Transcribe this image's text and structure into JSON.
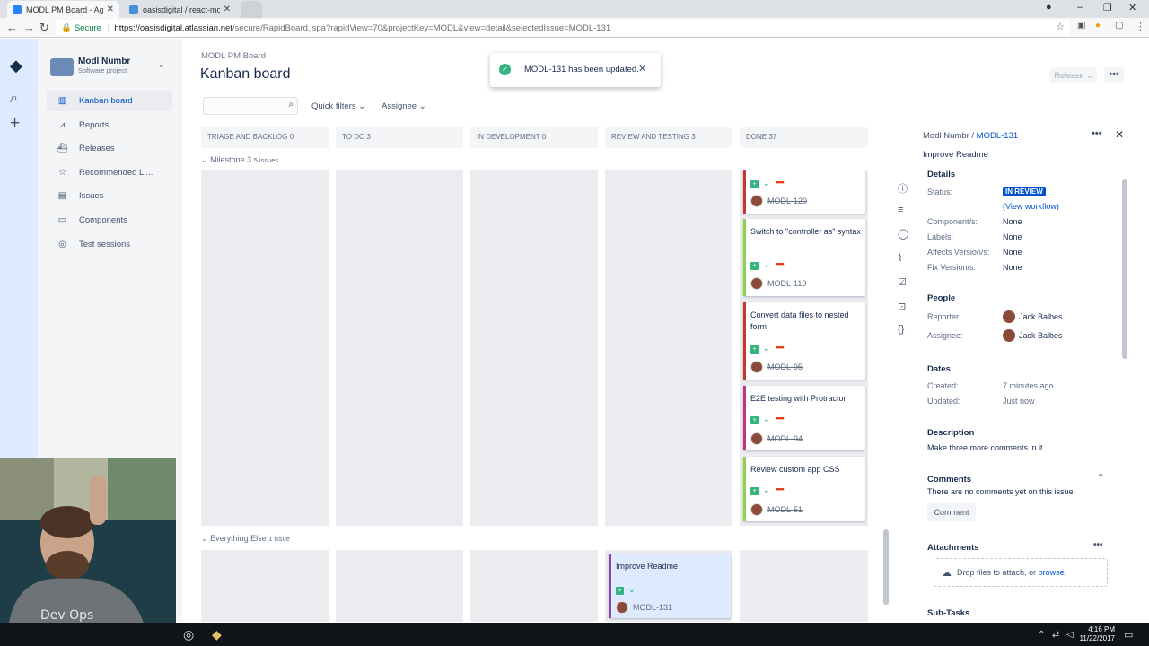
{
  "browser": {
    "tabs": [
      {
        "label": "MODL PM Board - Agile",
        "active": true
      },
      {
        "label": "oasisdigital / react-modl",
        "active": false
      }
    ],
    "secure_label": "Secure",
    "url_host": "https://oasisdigital.atlassian.net",
    "url_path": "/secure/RapidBoard.jspa?rapidView=70&projectKey=MODL&view=detail&selectedIssue=MODL-131"
  },
  "project": {
    "name": "Modl Numbr",
    "type": "Software project"
  },
  "nav": {
    "items": [
      {
        "label": "Kanban board",
        "icon": "board-icon",
        "selected": true
      },
      {
        "label": "Reports",
        "icon": "chart-icon",
        "selected": false
      },
      {
        "label": "Releases",
        "icon": "ship-icon",
        "selected": false
      },
      {
        "label": "Recommended Li...",
        "icon": "star-icon",
        "selected": false
      },
      {
        "label": "Issues",
        "icon": "issues-icon",
        "selected": false
      },
      {
        "label": "Components",
        "icon": "folder-icon",
        "selected": false
      },
      {
        "label": "Test sessions",
        "icon": "compass-icon",
        "selected": false
      }
    ]
  },
  "header": {
    "breadcrumb": "MODL PM Board",
    "title": "Kanban board",
    "quick_filters": "Quick filters",
    "assignee": "Assignee",
    "release": "Release"
  },
  "toast": {
    "message": "MODL-131 has been updated."
  },
  "board": {
    "columns": [
      "TRIAGE AND BACKLOG 0",
      "TO DO 3",
      "IN DEVELOPMENT 0",
      "REVIEW AND TESTING 3",
      "DONE 37"
    ],
    "swimlanes": [
      {
        "name": "Milestone 3",
        "count": "5 issues"
      },
      {
        "name": "Everything Else",
        "count": "1 issue"
      }
    ],
    "done_cards": [
      {
        "summary": "",
        "key": "MODL-120",
        "bar_color": "#c9372c"
      },
      {
        "summary": "Switch to \"controller as\" syntax",
        "key": "MODL-119",
        "bar_color": "#8fd14f"
      },
      {
        "summary": "Convert data files to nested form",
        "key": "MODL-95",
        "bar_color": "#c9372c"
      },
      {
        "summary": "E2E testing with Protractor",
        "key": "MODL-94",
        "bar_color": "#c4347b"
      },
      {
        "summary": "Review custom app CSS",
        "key": "MODL-51",
        "bar_color": "#8fd14f"
      }
    ],
    "review_card": {
      "summary": "Improve Readme",
      "key": "MODL-131",
      "bar_color": "#8e44ad"
    }
  },
  "detail": {
    "project": "Modl Numbr",
    "key": "MODL-131",
    "title": "Improve Readme",
    "details_heading": "Details",
    "fields": [
      {
        "label": "Status:",
        "value": "IN REVIEW"
      },
      {
        "label": "Component/s:",
        "value": "None"
      },
      {
        "label": "Labels:",
        "value": "None"
      },
      {
        "label": "Affects Version/s:",
        "value": "None"
      },
      {
        "label": "Fix Version/s:",
        "value": "None"
      }
    ],
    "view_workflow": "(View workflow)",
    "people_heading": "People",
    "reporter_label": "Reporter:",
    "reporter": "Jack Balbes",
    "assignee_label": "Assignee:",
    "assignee": "Jack Balbes",
    "dates_heading": "Dates",
    "created_label": "Created:",
    "created": "7 minutes ago",
    "updated_label": "Updated:",
    "updated": "Just now",
    "description_heading": "Description",
    "description": "Make three more comments in it",
    "comments_heading": "Comments",
    "no_comments": "There are no comments yet on this issue.",
    "comment_button": "Comment",
    "attachments_heading": "Attachments",
    "drop_text": "Drop files to attach, or",
    "browse": "browse.",
    "subtasks_heading": "Sub-Tasks"
  },
  "taskbar": {
    "time": "4:16 PM",
    "date": "11/22/2017"
  },
  "colors": {
    "accent": "#0052cc",
    "sidebar_global": "#deebff",
    "success": "#36b37e"
  }
}
